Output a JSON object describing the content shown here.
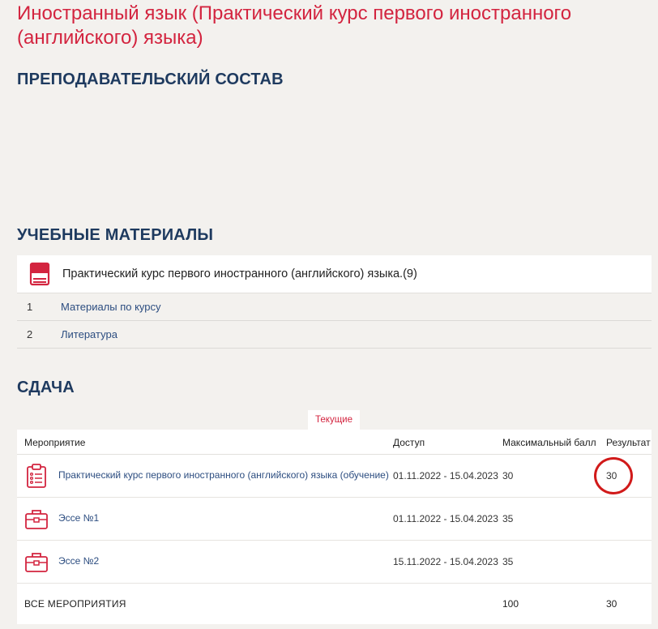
{
  "course": {
    "title": "Иностранный язык (Практический курс первого иностранного (английского) языка)"
  },
  "sections": {
    "staff": "ПРЕПОДАВАТЕЛЬСКИЙ СОСТАВ",
    "materials": "УЧЕБНЫЕ МАТЕРИАЛЫ",
    "exams": "СДАЧА"
  },
  "materials": {
    "title": "Практический курс первого иностранного (английского) языка.(9)",
    "icon": "book-icon",
    "items": [
      {
        "num": "1",
        "label": "Материалы по курсу"
      },
      {
        "num": "2",
        "label": "Литература"
      }
    ]
  },
  "exams": {
    "tab": "Текущие",
    "columns": {
      "event": "Мероприятие",
      "access": "Доступ",
      "max": "Максимальный балл",
      "result": "Результат"
    },
    "rows": [
      {
        "icon": "clipboard-list-icon",
        "name": "Практический курс первого иностранного (английского) языка (обучение)",
        "access": "01.11.2022 - 15.04.2023",
        "max": "30",
        "result": "30"
      },
      {
        "icon": "briefcase-icon",
        "name": "Эссе №1",
        "access": "01.11.2022 - 15.04.2023",
        "max": "35",
        "result": ""
      },
      {
        "icon": "briefcase-icon",
        "name": "Эссе №2",
        "access": "15.11.2022 - 15.04.2023",
        "max": "35",
        "result": ""
      }
    ],
    "total": {
      "label": "ВСЕ МЕРОПРИЯТИЯ",
      "max": "100",
      "result": "30"
    }
  },
  "colors": {
    "accent": "#d3243f",
    "heading": "#1e3a5f",
    "link": "#2c4d80",
    "annotation": "#d11a1a"
  }
}
